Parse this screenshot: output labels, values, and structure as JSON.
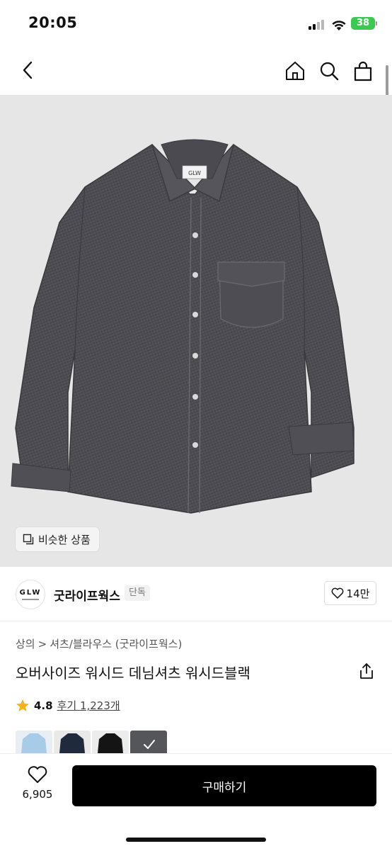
{
  "status": {
    "time": "20:05",
    "battery": "38"
  },
  "nav": {
    "back_icon": "chevron-left-icon",
    "home_icon": "home-icon",
    "search_icon": "search-icon",
    "cart_icon": "shopping-bag-icon"
  },
  "hero": {
    "shirt_label": "GLW",
    "similar_label": "비슷한 상품",
    "similar_icon": "copy-icon"
  },
  "brand": {
    "logo_text": "GLW",
    "name": "굿라이프웍스",
    "badge": "단독",
    "likes": "14만"
  },
  "breadcrumb": {
    "category": "상의",
    "separator": ">",
    "subcategory": "셔츠/블라우스 (굿라이프웍스)"
  },
  "product": {
    "title": "오버사이즈 워시드 데님셔츠 워시드블랙",
    "rating": "4.8",
    "reviews": "후기 1,223개"
  },
  "swatches": [
    {
      "name": "light-blue",
      "color": "#a8cbe8"
    },
    {
      "name": "navy",
      "color": "#1f2a3c"
    },
    {
      "name": "black",
      "color": "#141414"
    },
    {
      "name": "washed-black",
      "color": "#55565a",
      "selected": true
    }
  ],
  "bottom": {
    "wish_count": "6,905",
    "buy_label": "구매하기"
  },
  "colors": {
    "accent": "#000000",
    "star": "#f6b01c",
    "battery": "#3cc853"
  }
}
